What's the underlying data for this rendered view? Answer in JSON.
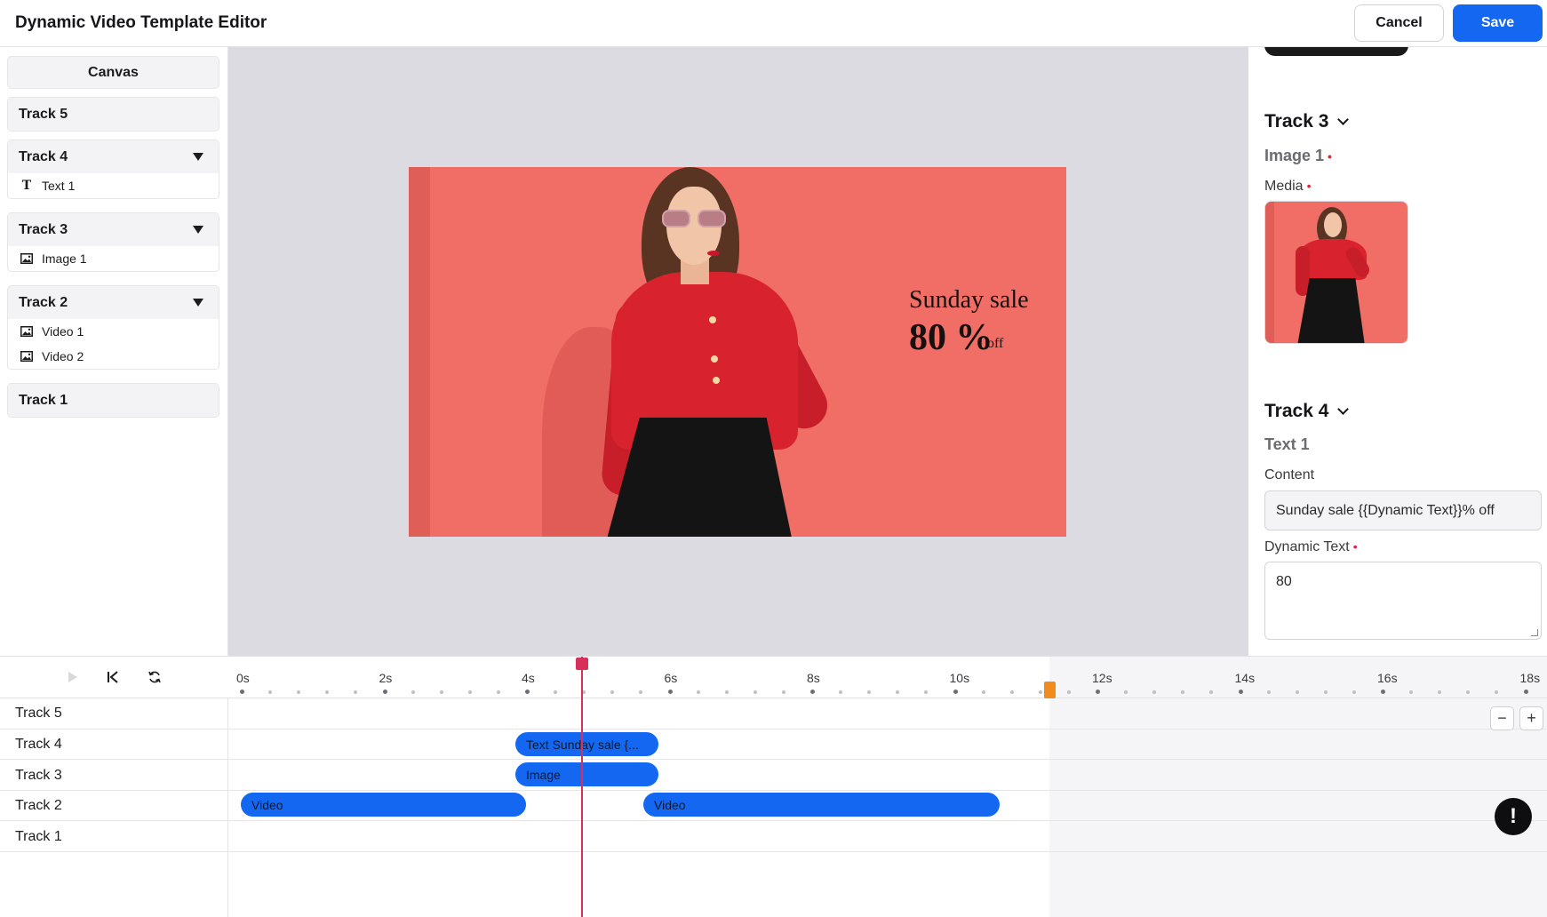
{
  "header": {
    "title": "Dynamic Video Template Editor",
    "cancel_label": "Cancel",
    "save_label": "Save"
  },
  "sidebar": {
    "canvas_label": "Canvas",
    "tracks": [
      {
        "label": "Track 5",
        "items": []
      },
      {
        "label": "Track 4",
        "items": [
          {
            "label": "Text 1",
            "icon": "text-icon"
          }
        ]
      },
      {
        "label": "Track 3",
        "items": [
          {
            "label": "Image 1",
            "icon": "image-icon"
          }
        ]
      },
      {
        "label": "Track 2",
        "items": [
          {
            "label": "Video 1",
            "icon": "image-icon"
          },
          {
            "label": "Video 2",
            "icon": "image-icon"
          }
        ]
      },
      {
        "label": "Track 1",
        "items": []
      }
    ]
  },
  "preview": {
    "sale_title": "Sunday sale",
    "sale_value": "80",
    "sale_percent": "%",
    "sale_off": "off"
  },
  "properties": {
    "track3": {
      "title": "Track 3",
      "item_title": "Image 1",
      "media_label": "Media"
    },
    "track4": {
      "title": "Track 4",
      "item_title": "Text 1",
      "content_label": "Content",
      "content_value": "Sunday sale {{Dynamic Text}}% off",
      "dynamic_text_label": "Dynamic Text",
      "dynamic_text_value": "80"
    }
  },
  "timeline": {
    "ticks": [
      "0s",
      "2s",
      "4s",
      "6s",
      "8s",
      "10s",
      "12s",
      "14s",
      "16s",
      "18s"
    ],
    "rows": [
      "Track 5",
      "Track 4",
      "Track 3",
      "Track 2",
      "Track 1"
    ],
    "clips": {
      "track4_text": "Text Sunday sale {...",
      "track3_image": "Image",
      "track2_video_a": "Video",
      "track2_video_b": "Video"
    },
    "zoom_out": "−",
    "zoom_in": "+"
  },
  "colors": {
    "accent": "#1467f0",
    "playhead": "#d7305a",
    "end_marker": "#f08c1e",
    "required": "#e0243a"
  }
}
